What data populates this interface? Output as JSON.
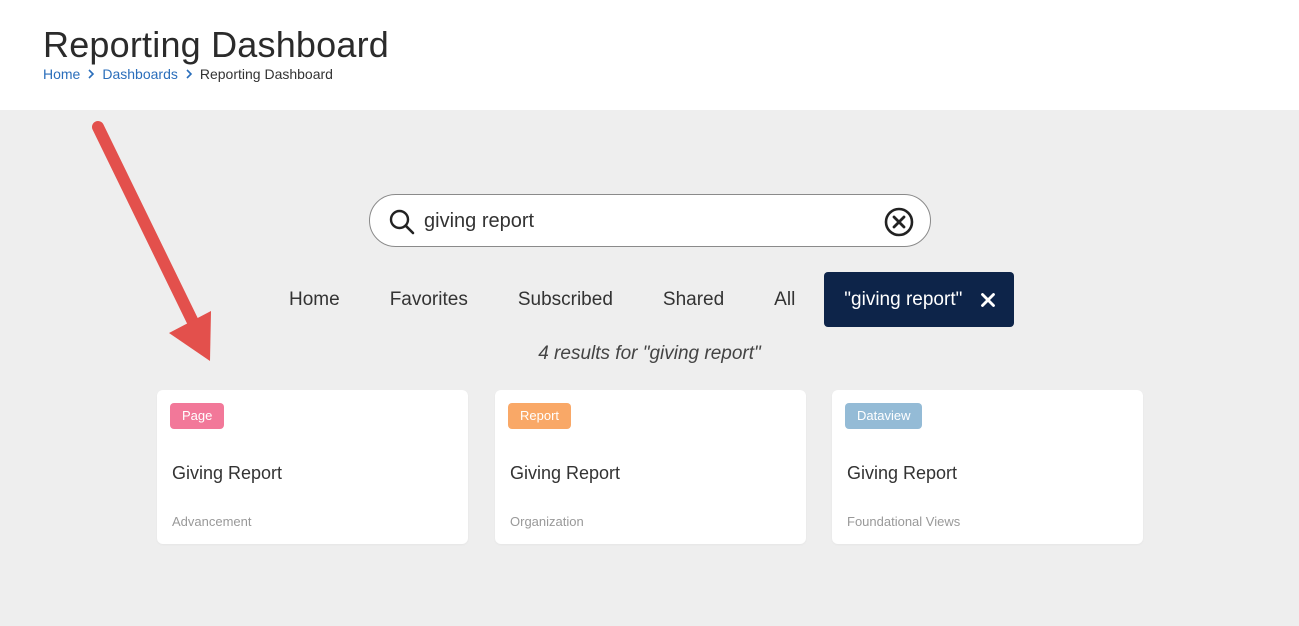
{
  "header": {
    "title": "Reporting Dashboard",
    "breadcrumb": {
      "home": "Home",
      "dashboards": "Dashboards",
      "current": "Reporting Dashboard"
    }
  },
  "search": {
    "value": "giving report",
    "placeholder": ""
  },
  "tabs": [
    {
      "label": "Home"
    },
    {
      "label": "Favorites"
    },
    {
      "label": "Subscribed"
    },
    {
      "label": "Shared"
    },
    {
      "label": "All"
    },
    {
      "label": "\"giving report\"",
      "active": true
    }
  ],
  "results_text": "4 results for \"giving report\"",
  "cards": [
    {
      "badge": "Page",
      "badge_color": "#f27899",
      "title": "Giving Report",
      "subtitle": "Advancement"
    },
    {
      "badge": "Report",
      "badge_color": "#f9a867",
      "title": "Giving Report",
      "subtitle": "Organization"
    },
    {
      "badge": "Dataview",
      "badge_color": "#94bbd6",
      "title": "Giving Report",
      "subtitle": "Foundational Views"
    }
  ],
  "colors": {
    "active_tab_bg": "#0d2449",
    "link": "#2a6ebb",
    "main_bg": "#eeeeee",
    "arrow": "#e3504c"
  }
}
